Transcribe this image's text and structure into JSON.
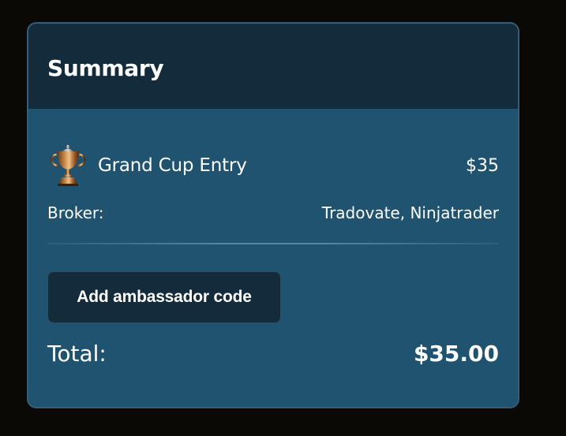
{
  "summary": {
    "title": "Summary",
    "item": {
      "icon": "trophy-icon",
      "name": "Grand Cup Entry",
      "price": "$35"
    },
    "broker": {
      "label": "Broker:",
      "value": "Tradovate, Ninjatrader"
    },
    "ambassador_button_label": "Add ambassador code",
    "total": {
      "label": "Total:",
      "value": "$35.00"
    }
  },
  "colors": {
    "page_background": "#0a0906",
    "card_background": "#1f5370",
    "header_background": "#142b3c",
    "button_background": "#142b3c",
    "border": "#355d79"
  }
}
